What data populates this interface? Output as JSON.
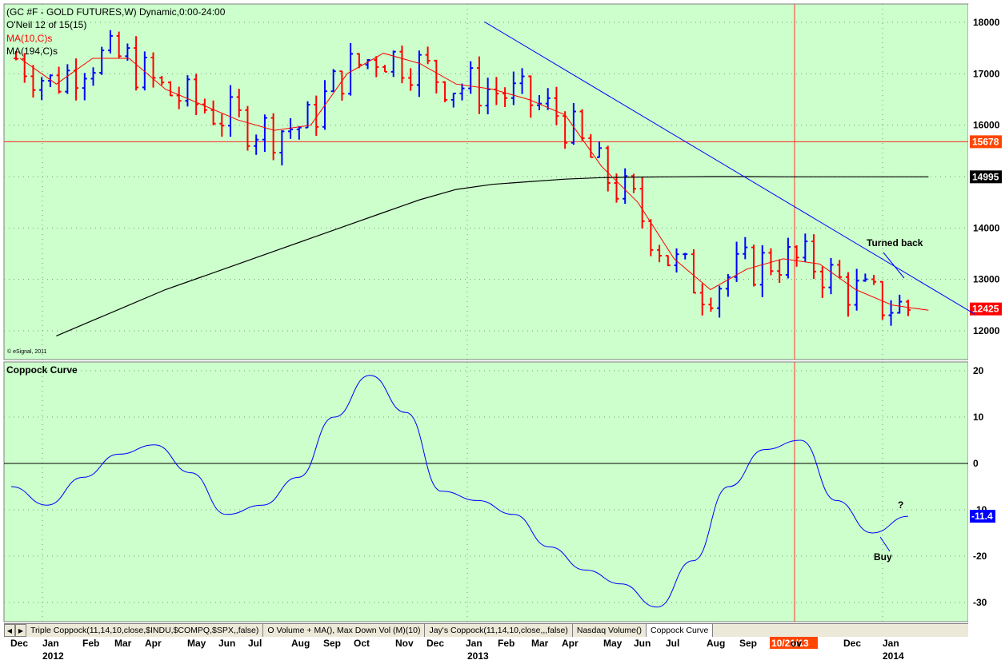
{
  "price_panel": {
    "title": "(GC #F - GOLD FUTURES,W) Dynamic,0:00-24:00",
    "study": "O'Neil 12 of 15(15)",
    "ma_short_label": "MA(10,C)s",
    "ma_long_label": "MA(194,C)s",
    "copyright": "© eSignal, 2011",
    "annotation": "Turned back",
    "y_ticks": [
      "18000",
      "17000",
      "16000",
      "15000",
      "14000",
      "13000",
      "12000"
    ],
    "price_tags": [
      {
        "label": "15678",
        "value": 15678,
        "color": "#ff4500"
      },
      {
        "label": "14995",
        "value": 14995,
        "color": "#000000"
      },
      {
        "label": "12425",
        "value": 12425,
        "color": "#ff0000"
      }
    ]
  },
  "coppock_panel": {
    "title": "Coppock Curve",
    "y_ticks": [
      "20",
      "10",
      "0",
      "-10",
      "-20",
      "-30"
    ],
    "value_tag": "-11.4",
    "annotation_buy": "Buy",
    "annotation_q": "?"
  },
  "x_axis": {
    "months": [
      "Dec",
      "Jan",
      "Feb",
      "Mar",
      "Apr",
      "May",
      "Jun",
      "Jul",
      "Aug",
      "Sep",
      "Oct",
      "Nov",
      "Dec",
      "Jan",
      "Feb",
      "Mar",
      "Apr",
      "May",
      "Jun",
      "Jul",
      "Aug",
      "Sep",
      "ov",
      "Dec",
      "Jan"
    ],
    "years": [
      "2012",
      "2013",
      "2014"
    ],
    "cursor_date": "10/21/13"
  },
  "tabs": [
    "Triple Coppock(11,14,10,close,$INDU,$COMPQ,$SPX,,false)",
    "O Volume + MA(), Max Down Vol (M)(10)",
    "Jay's Coppock(11,14,10,close,,,false)",
    "Nasdaq Volume()",
    "Coppock Curve"
  ],
  "colors": {
    "panel_bg": "#ccffcc",
    "up_bar": "#0000ff",
    "down_bar": "#ff0000",
    "ma_short": "#ff0000",
    "ma_long": "#000000",
    "trendline": "#0000ff",
    "coppock": "#0000ff"
  },
  "chart_data": [
    {
      "type": "line",
      "title": "(GC #F - GOLD FUTURES,W) Dynamic,0:00-24:00",
      "ylim": [
        11500,
        18300
      ],
      "x": [
        "Dec 2011",
        "Jan 2012",
        "Feb 2012",
        "Mar 2012",
        "Apr 2012",
        "May 2012",
        "Jun 2012",
        "Jul 2012",
        "Aug 2012",
        "Sep 2012",
        "Oct 2012",
        "Nov 2012",
        "Dec 2012",
        "Jan 2013",
        "Feb 2013",
        "Mar 2013",
        "Apr 2013",
        "May 2013",
        "Jun 2013",
        "Jul 2013",
        "Aug 2013",
        "Sep 2013",
        "Oct 2013",
        "Nov 2013",
        "Dec 2013",
        "Jan 2014"
      ],
      "series": [
        {
          "name": "MA(10,C)s",
          "values": [
            17300,
            16800,
            17300,
            17300,
            16700,
            16400,
            16100,
            15900,
            16000,
            17000,
            17400,
            17200,
            16800,
            16700,
            16500,
            16200,
            15200,
            14500,
            13400,
            12800,
            13200,
            13400,
            13300,
            12800,
            12500,
            12400
          ]
        },
        {
          "name": "MA(194,C)s",
          "values": [
            null,
            11900,
            12200,
            12500,
            12800,
            13050,
            13300,
            13550,
            13800,
            14050,
            14300,
            14550,
            14750,
            14850,
            14900,
            14950,
            14980,
            14990,
            14995,
            15000,
            15000,
            14995,
            14995,
            14995,
            14995,
            14995
          ]
        }
      ],
      "horizontal_line": 15678,
      "trendline": {
        "from": [
          "Jan 2013",
          17700
        ],
        "to": [
          "Jan 2014",
          12400
        ]
      },
      "last_value": 12425
    },
    {
      "type": "line",
      "title": "Coppock Curve",
      "ylim": [
        -33,
        22
      ],
      "x": [
        "Dec 2011",
        "Jan 2012",
        "Feb 2012",
        "Mar 2012",
        "Apr 2012",
        "May 2012",
        "Jun 2012",
        "Jul 2012",
        "Aug 2012",
        "Sep 2012",
        "Oct 2012",
        "Nov 2012",
        "Dec 2012",
        "Jan 2013",
        "Feb 2013",
        "Mar 2013",
        "Apr 2013",
        "May 2013",
        "Jun 2013",
        "Jul 2013",
        "Aug 2013",
        "Sep 2013",
        "Oct 2013",
        "Nov 2013",
        "Dec 2013",
        "Jan 2014"
      ],
      "series": [
        {
          "name": "Coppock Curve",
          "values": [
            -5,
            -9,
            -3,
            2,
            4,
            -2,
            -11,
            -9,
            -3,
            10,
            19,
            11,
            -6,
            -8,
            -11,
            -18,
            -23,
            -26,
            -31,
            -21,
            -5,
            3,
            5,
            -8,
            -15,
            -11.4
          ]
        }
      ],
      "last_value": -11.4
    }
  ]
}
